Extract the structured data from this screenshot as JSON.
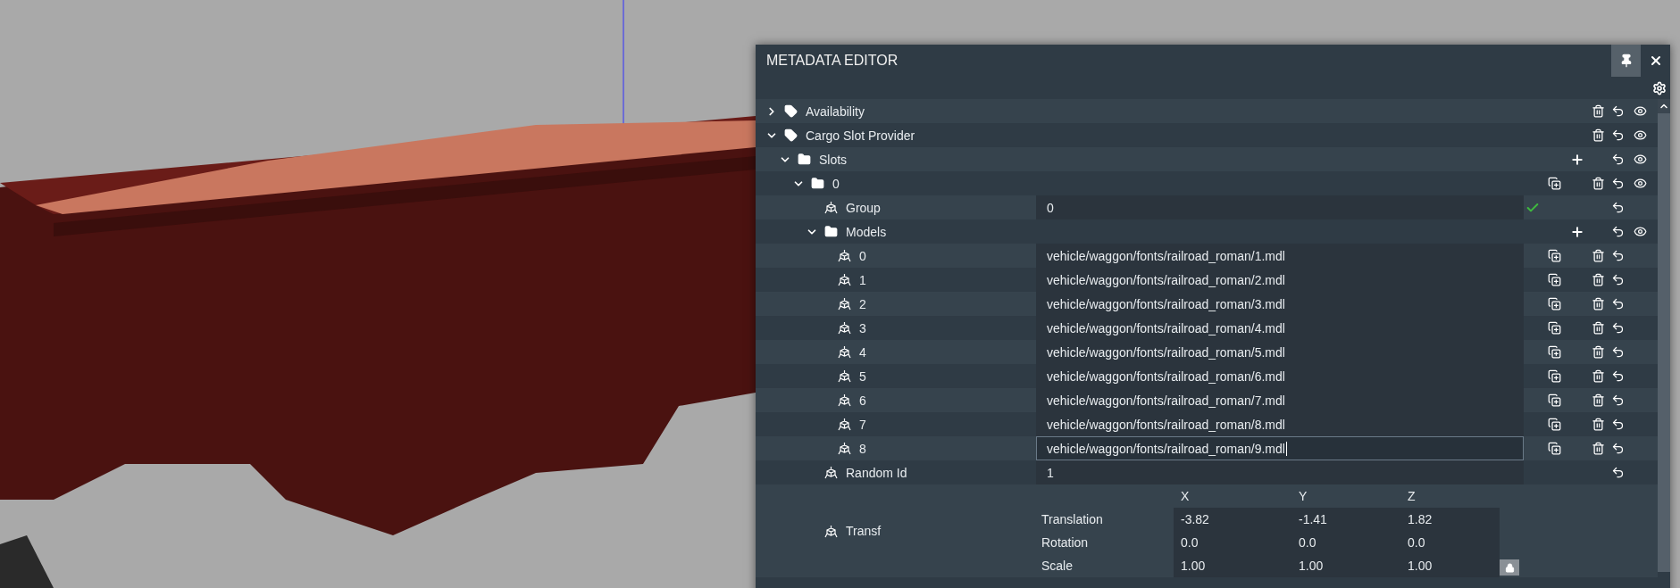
{
  "window": {
    "title": "METADATA EDITOR",
    "pinned": true
  },
  "tree": [
    {
      "kind": "component",
      "label": "Availability",
      "expanded": false,
      "actions": [
        {
          "kind": "delete"
        },
        {
          "kind": "reset"
        },
        {
          "kind": "visibility"
        }
      ]
    },
    {
      "kind": "component",
      "label": "Cargo Slot Provider",
      "expanded": true,
      "actions": [
        {
          "kind": "delete"
        },
        {
          "kind": "reset"
        },
        {
          "kind": "visibility"
        }
      ],
      "children": [
        {
          "kind": "folder",
          "label": "Slots",
          "expanded": true,
          "actions": [
            {
              "kind": "add"
            },
            {
              "kind": "reset"
            },
            {
              "kind": "visibility"
            }
          ],
          "children": [
            {
              "kind": "folder",
              "label": "0",
              "expanded": true,
              "actions": [
                {
                  "kind": "duplicate"
                },
                {
                  "kind": "delete"
                },
                {
                  "kind": "reset"
                },
                {
                  "kind": "visibility"
                }
              ],
              "children": [
                {
                  "kind": "field",
                  "label": "Group",
                  "value": "0",
                  "valid": true,
                  "actions": [
                    {
                      "kind": "reset"
                    }
                  ]
                },
                {
                  "kind": "folder",
                  "label": "Models",
                  "expanded": true,
                  "actions": [
                    {
                      "kind": "add"
                    },
                    {
                      "kind": "reset"
                    },
                    {
                      "kind": "visibility"
                    }
                  ],
                  "children": [
                    {
                      "kind": "field",
                      "label": "0",
                      "value": "vehicle/waggon/fonts/railroad_roman/1.mdl",
                      "focused": false,
                      "actions": [
                        {
                          "kind": "duplicate"
                        },
                        {
                          "kind": "delete"
                        },
                        {
                          "kind": "reset"
                        }
                      ]
                    },
                    {
                      "kind": "field",
                      "label": "1",
                      "value": "vehicle/waggon/fonts/railroad_roman/2.mdl",
                      "focused": false,
                      "actions": [
                        {
                          "kind": "duplicate"
                        },
                        {
                          "kind": "delete"
                        },
                        {
                          "kind": "reset"
                        }
                      ]
                    },
                    {
                      "kind": "field",
                      "label": "2",
                      "value": "vehicle/waggon/fonts/railroad_roman/3.mdl",
                      "focused": false,
                      "actions": [
                        {
                          "kind": "duplicate"
                        },
                        {
                          "kind": "delete"
                        },
                        {
                          "kind": "reset"
                        }
                      ]
                    },
                    {
                      "kind": "field",
                      "label": "3",
                      "value": "vehicle/waggon/fonts/railroad_roman/4.mdl",
                      "focused": false,
                      "actions": [
                        {
                          "kind": "duplicate"
                        },
                        {
                          "kind": "delete"
                        },
                        {
                          "kind": "reset"
                        }
                      ]
                    },
                    {
                      "kind": "field",
                      "label": "4",
                      "value": "vehicle/waggon/fonts/railroad_roman/5.mdl",
                      "focused": false,
                      "actions": [
                        {
                          "kind": "duplicate"
                        },
                        {
                          "kind": "delete"
                        },
                        {
                          "kind": "reset"
                        }
                      ]
                    },
                    {
                      "kind": "field",
                      "label": "5",
                      "value": "vehicle/waggon/fonts/railroad_roman/6.mdl",
                      "focused": false,
                      "actions": [
                        {
                          "kind": "duplicate"
                        },
                        {
                          "kind": "delete"
                        },
                        {
                          "kind": "reset"
                        }
                      ]
                    },
                    {
                      "kind": "field",
                      "label": "6",
                      "value": "vehicle/waggon/fonts/railroad_roman/7.mdl",
                      "focused": false,
                      "actions": [
                        {
                          "kind": "duplicate"
                        },
                        {
                          "kind": "delete"
                        },
                        {
                          "kind": "reset"
                        }
                      ]
                    },
                    {
                      "kind": "field",
                      "label": "7",
                      "value": "vehicle/waggon/fonts/railroad_roman/8.mdl",
                      "focused": false,
                      "actions": [
                        {
                          "kind": "duplicate"
                        },
                        {
                          "kind": "delete"
                        },
                        {
                          "kind": "reset"
                        }
                      ]
                    },
                    {
                      "kind": "field",
                      "label": "8",
                      "value": "vehicle/waggon/fonts/railroad_roman/9.mdl",
                      "focused": true,
                      "actions": [
                        {
                          "kind": "duplicate"
                        },
                        {
                          "kind": "delete"
                        },
                        {
                          "kind": "reset"
                        }
                      ]
                    }
                  ]
                },
                {
                  "kind": "field",
                  "label": "Random Id",
                  "value": "1",
                  "valid": false,
                  "actions": [
                    {
                      "kind": "reset"
                    }
                  ]
                },
                {
                  "kind": "transform",
                  "label": "Transf",
                  "columns": [
                    "X",
                    "Y",
                    "Z"
                  ],
                  "locked": true,
                  "rows": [
                    {
                      "label": "Translation",
                      "values": [
                        "-3.82",
                        "-1.41",
                        "1.82"
                      ]
                    },
                    {
                      "label": "Rotation",
                      "values": [
                        "0.0",
                        "0.0",
                        "0.0"
                      ]
                    },
                    {
                      "label": "Scale",
                      "values": [
                        "1.00",
                        "1.00",
                        "1.00"
                      ]
                    }
                  ]
                }
              ]
            }
          ]
        }
      ]
    }
  ]
}
